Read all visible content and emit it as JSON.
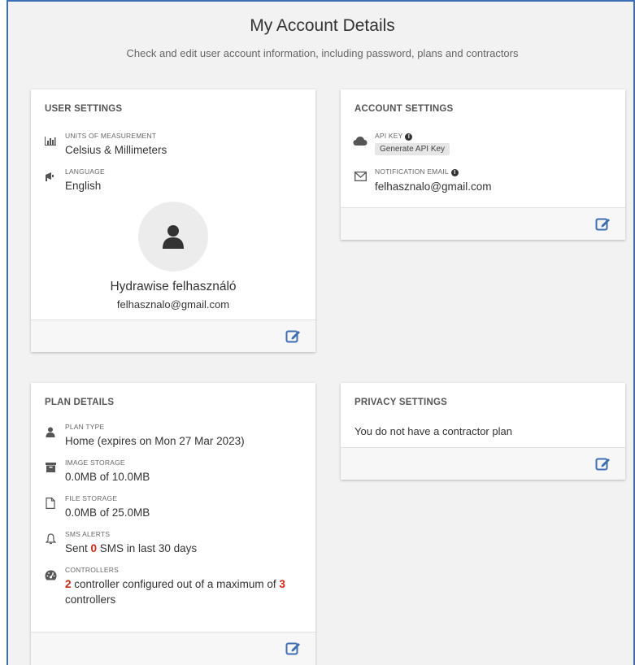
{
  "page": {
    "title": "My Account Details",
    "subtitle": "Check and edit user account information, including password, plans and contractors"
  },
  "user_settings": {
    "header": "USER SETTINGS",
    "units_label": "UNITS OF MEASUREMENT",
    "units_value": "Celsius & Millimeters",
    "language_label": "LANGUAGE",
    "language_value": "English",
    "user_name": "Hydrawise felhasználó",
    "user_email": "felhasznalo@gmail.com"
  },
  "account_settings": {
    "header": "ACCOUNT SETTINGS",
    "api_key_label": "API KEY",
    "api_key_button": "Generate API Key",
    "notification_email_label": "NOTIFICATION EMAIL",
    "notification_email_value": "felhasznalo@gmail.com"
  },
  "plan_details": {
    "header": "PLAN DETAILS",
    "plan_type_label": "PLAN TYPE",
    "plan_type_value": "Home (expires on Mon 27 Mar 2023)",
    "image_storage_label": "IMAGE STORAGE",
    "image_storage_value": "0.0MB of 10.0MB",
    "file_storage_label": "FILE STORAGE",
    "file_storage_value": "0.0MB of 25.0MB",
    "sms_label": "SMS ALERTS",
    "sms_prefix": "Sent ",
    "sms_count": "0",
    "sms_suffix": " SMS in last 30 days",
    "controllers_label": "CONTROLLERS",
    "controllers_count": "2",
    "controllers_middle": " controller configured out of a maximum of ",
    "controllers_max": "3",
    "controllers_suffix": " controllers"
  },
  "privacy_settings": {
    "header": "PRIVACY SETTINGS",
    "message": "You do not have a contractor plan"
  },
  "icons": {
    "units": "bar-chart-icon",
    "language": "megaphone-icon",
    "avatar": "user-icon",
    "edit": "edit-icon",
    "api_key": "cloud-icon",
    "email": "envelope-icon",
    "plan_type": "user-icon",
    "image_storage": "archive-icon",
    "file_storage": "file-icon",
    "sms": "bell-icon",
    "controllers": "dashboard-icon",
    "info": "info-circle-icon"
  },
  "colors": {
    "accent_blue": "#3d6fb6",
    "highlight_red": "#d9230f",
    "background": "#f2f2f2"
  }
}
